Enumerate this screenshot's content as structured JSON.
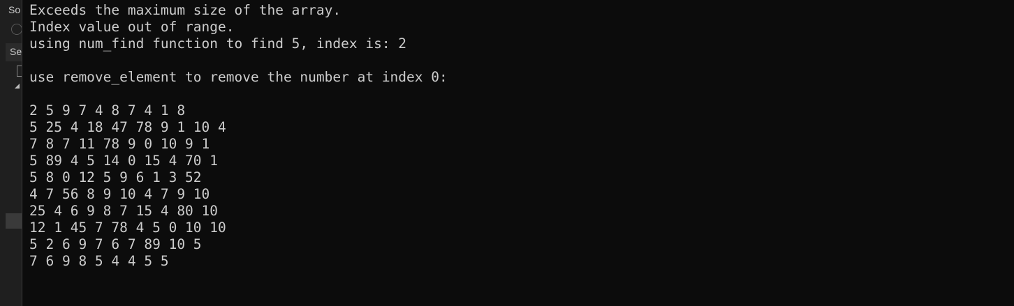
{
  "ide_panel": {
    "fragment_top": "So",
    "fragment_tab": "Se"
  },
  "console": {
    "messages": [
      "Exceeds the maximum size of the array.",
      "Index value out of range.",
      "using num_find function to find 5, index is: 2"
    ],
    "remove_message": "use remove_element to remove the number at index 0:",
    "array_rows": [
      "2 5 9 7 4 8 7 4 1 8",
      "5 25 4 18 47 78 9 1 10 4",
      "7 8 7 11 78 9 0 10 9 1",
      "5 89 4 5 14 0 15 4 70 1",
      "5 8 0 12 5 9 6 1 3 52",
      "4 7 56 8 9 10 4 7 9 10",
      "25 4 6 9 8 7 15 4 80 10",
      "12 1 45 7 78 4 5 0 10 10",
      "5 2 6 9 7 6 7 89 10 5",
      "7 6 9 8 5 4 4 5 5"
    ]
  }
}
